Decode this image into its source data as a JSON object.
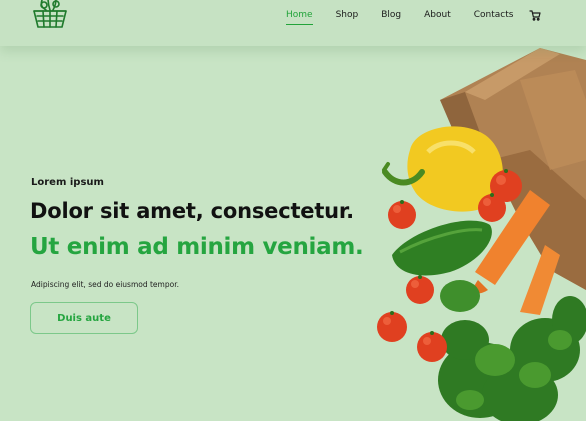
{
  "nav": {
    "items": [
      {
        "label": "Home",
        "active": true
      },
      {
        "label": "Shop",
        "active": false
      },
      {
        "label": "Blog",
        "active": false
      },
      {
        "label": "About",
        "active": false
      },
      {
        "label": "Contacts",
        "active": false
      }
    ],
    "cart_icon": "cart-icon",
    "logo_icon": "basket-logo-icon"
  },
  "hero": {
    "eyebrow": "Lorem ipsum",
    "headline_1": "Dolor sit amet, consectetur.",
    "headline_2": "Ut enim ad minim veniam.",
    "subtext": "Adipiscing elit, sed do eiusmod tempor.",
    "cta_label": "Duis aute",
    "image": "grocery-bag-vegetables"
  },
  "colors": {
    "background": "#c8e4c5",
    "accent_green": "#25a540",
    "text_dark": "#111111"
  }
}
